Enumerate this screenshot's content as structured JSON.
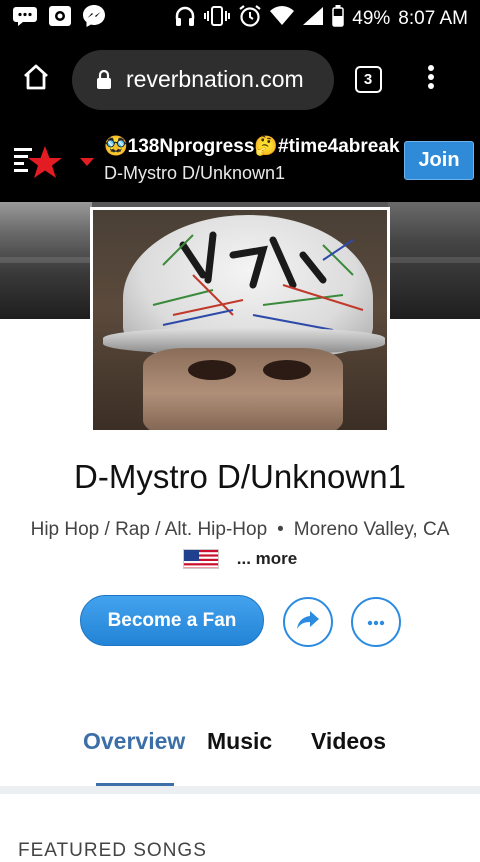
{
  "status_bar": {
    "battery": "49%",
    "time": "8:07 AM"
  },
  "browser": {
    "url": "reverbnation.com",
    "tab_count": "3"
  },
  "site_header": {
    "title_line": "🥸138Nprogress🤔#time4abreak",
    "subtitle": "D-Mystro D/Unknown1",
    "join_label": "Join"
  },
  "artist": {
    "name": "D-Mystro D/Unknown1",
    "genres": "Hip Hop / Rap / Alt. Hip-Hop",
    "separator": "•",
    "location": "Moreno Valley, CA",
    "more_label": "... more"
  },
  "actions": {
    "fan_label": "Become a Fan"
  },
  "tabs": [
    {
      "label": "Overview",
      "active": true
    },
    {
      "label": "Music",
      "active": false
    },
    {
      "label": "Videos",
      "active": false
    }
  ],
  "sections": {
    "featured_songs": "FEATURED SONGS"
  },
  "colors": {
    "accent": "#2f8bd8",
    "tab_active": "#3c6fa8",
    "brand_red": "#e31b23"
  }
}
